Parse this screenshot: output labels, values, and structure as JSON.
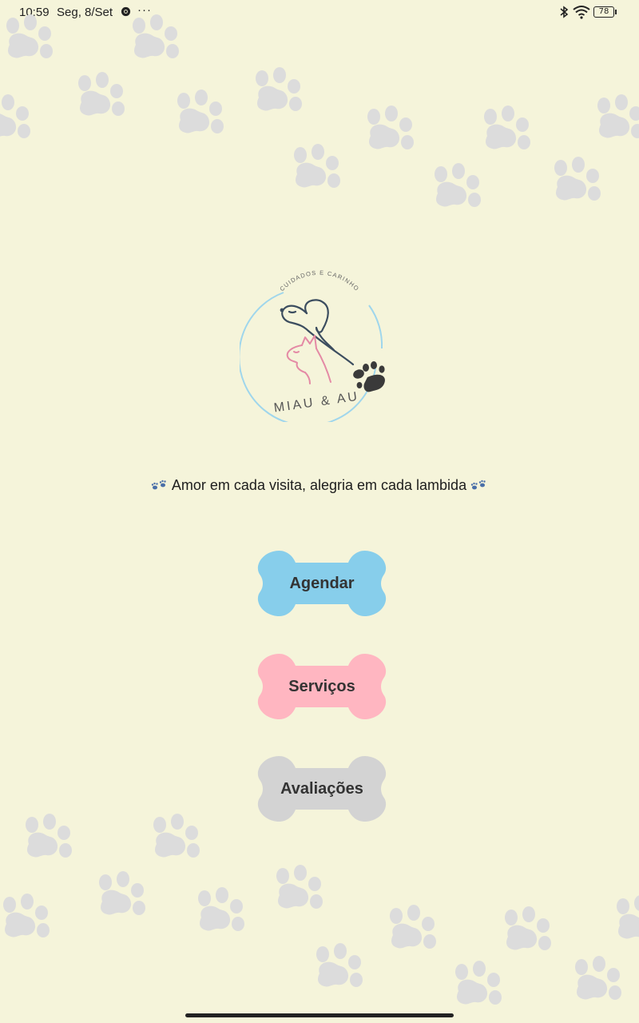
{
  "status_bar": {
    "time": "10:59",
    "date": "Seg, 8/Set",
    "more": "···",
    "battery": "78"
  },
  "logo": {
    "arc_text": "CUIDADOS E CARINHO",
    "brand": "MIAU & AU"
  },
  "tagline": {
    "text": "Amor em cada visita, alegria em cada lambida"
  },
  "buttons": [
    {
      "label": "Agendar",
      "color": "#87ceeb"
    },
    {
      "label": "Serviços",
      "color": "#ffb6c1"
    },
    {
      "label": "Avaliações",
      "color": "#d3d3d3"
    }
  ],
  "colors": {
    "background": "#f5f4da",
    "paw_pattern": "#dcdcdc",
    "logo_dog": "#3c4d5f",
    "logo_cat": "#e48aa5",
    "logo_ring": "#9fd6ec"
  }
}
